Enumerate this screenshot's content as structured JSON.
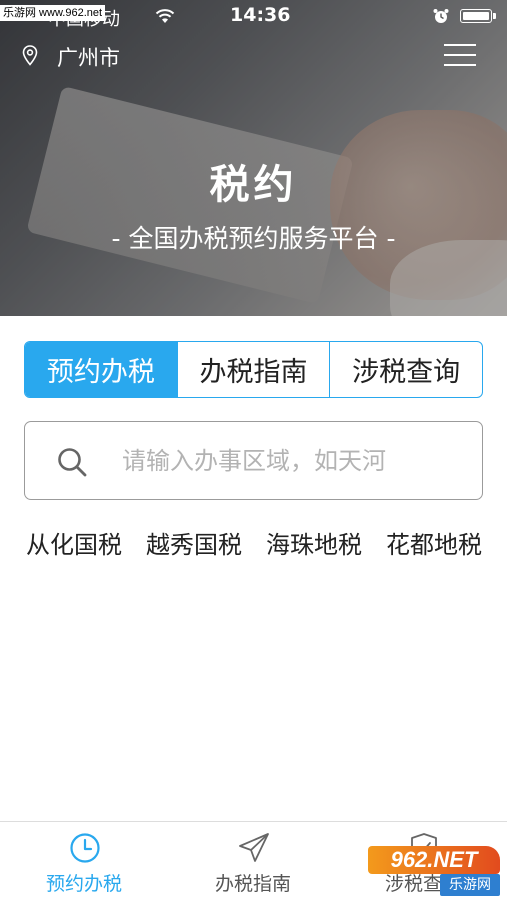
{
  "status_bar": {
    "carrier": "中国移动",
    "time": "14:36"
  },
  "watermark": {
    "top": "乐游网 www.962.net",
    "bottom_badge": "962.NET",
    "bottom_site": "乐游网"
  },
  "header": {
    "city": "广州市"
  },
  "hero": {
    "title": "税约",
    "subtitle": "- 全国办税预约服务平台 -"
  },
  "tabs": [
    {
      "label": "预约办税",
      "active": true
    },
    {
      "label": "办税指南",
      "active": false
    },
    {
      "label": "涉税查询",
      "active": false
    }
  ],
  "search": {
    "placeholder": "请输入办事区域，如天河",
    "value": ""
  },
  "quick_links": [
    "从化国税",
    "越秀国税",
    "海珠地税",
    "花都地税"
  ],
  "bottom_nav": [
    {
      "label": "预约办税",
      "icon": "clock-icon",
      "active": true
    },
    {
      "label": "办税指南",
      "icon": "paper-plane-icon",
      "active": false
    },
    {
      "label": "涉税查询",
      "icon": "shield-check-icon",
      "active": false
    }
  ],
  "colors": {
    "accent": "#29a8ee",
    "text": "#222222",
    "placeholder": "#b3b3b3"
  }
}
